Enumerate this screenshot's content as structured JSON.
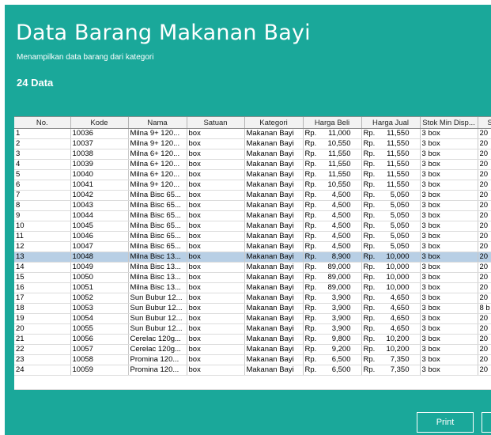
{
  "header": {
    "title": "Data Barang Makanan Bayi",
    "subtitle": "Menampilkan data barang dari kategori",
    "count": "24 Data"
  },
  "table": {
    "columns": [
      "No.",
      "Kode",
      "Nama",
      "Satuan",
      "Kategori",
      "Harga Beli",
      "Harga Jual",
      "Stok Min Disp...",
      "St"
    ],
    "selected_row_index": 12,
    "rows": [
      [
        "1",
        "10036",
        "Milna 9+ 120...",
        "box",
        "Makanan Bayi",
        "Rp.",
        "11,000",
        "Rp.",
        "11,550",
        "3 box",
        "20"
      ],
      [
        "2",
        "10037",
        "Milna 9+ 120...",
        "box",
        "Makanan Bayi",
        "Rp.",
        "10,550",
        "Rp.",
        "11,550",
        "3 box",
        "20"
      ],
      [
        "3",
        "10038",
        "Milna 6+ 120...",
        "box",
        "Makanan Bayi",
        "Rp.",
        "11,550",
        "Rp.",
        "11,550",
        "3 box",
        "20"
      ],
      [
        "4",
        "10039",
        "Milna 6+ 120...",
        "box",
        "Makanan Bayi",
        "Rp.",
        "11,550",
        "Rp.",
        "11,550",
        "3 box",
        "20"
      ],
      [
        "5",
        "10040",
        "Milna 6+ 120...",
        "box",
        "Makanan Bayi",
        "Rp.",
        "11,550",
        "Rp.",
        "11,550",
        "3 box",
        "20"
      ],
      [
        "6",
        "10041",
        "Milna 9+ 120...",
        "box",
        "Makanan Bayi",
        "Rp.",
        "10,550",
        "Rp.",
        "11,550",
        "3 box",
        "20"
      ],
      [
        "7",
        "10042",
        "Milna Bisc 65...",
        "box",
        "Makanan Bayi",
        "Rp.",
        "4,500",
        "Rp.",
        "5,050",
        "3 box",
        "20"
      ],
      [
        "8",
        "10043",
        "Milna Bisc 65...",
        "box",
        "Makanan Bayi",
        "Rp.",
        "4,500",
        "Rp.",
        "5,050",
        "3 box",
        "20"
      ],
      [
        "9",
        "10044",
        "Milna Bisc 65...",
        "box",
        "Makanan Bayi",
        "Rp.",
        "4,500",
        "Rp.",
        "5,050",
        "3 box",
        "20"
      ],
      [
        "10",
        "10045",
        "Milna Bisc 65...",
        "box",
        "Makanan Bayi",
        "Rp.",
        "4,500",
        "Rp.",
        "5,050",
        "3 box",
        "20"
      ],
      [
        "11",
        "10046",
        "Milna Bisc 65...",
        "box",
        "Makanan Bayi",
        "Rp.",
        "4,500",
        "Rp.",
        "5,050",
        "3 box",
        "20"
      ],
      [
        "12",
        "10047",
        "Milna Bisc 65...",
        "box",
        "Makanan Bayi",
        "Rp.",
        "4,500",
        "Rp.",
        "5,050",
        "3 box",
        "20"
      ],
      [
        "13",
        "10048",
        "Milna Bisc 13...",
        "box",
        "Makanan Bayi",
        "Rp.",
        "8,900",
        "Rp.",
        "10,000",
        "3 box",
        "20"
      ],
      [
        "14",
        "10049",
        "Milna Bisc 13...",
        "box",
        "Makanan Bayi",
        "Rp.",
        "89,000",
        "Rp.",
        "10,000",
        "3 box",
        "20"
      ],
      [
        "15",
        "10050",
        "Milna Bisc 13...",
        "box",
        "Makanan Bayi",
        "Rp.",
        "89,000",
        "Rp.",
        "10,000",
        "3 box",
        "20"
      ],
      [
        "16",
        "10051",
        "Milna Bisc 13...",
        "box",
        "Makanan Bayi",
        "Rp.",
        "89,000",
        "Rp.",
        "10,000",
        "3 box",
        "20"
      ],
      [
        "17",
        "10052",
        "Sun Bubur 12...",
        "box",
        "Makanan Bayi",
        "Rp.",
        "3,900",
        "Rp.",
        "4,650",
        "3 box",
        "20"
      ],
      [
        "18",
        "10053",
        "Sun Bubur 12...",
        "box",
        "Makanan Bayi",
        "Rp.",
        "3,900",
        "Rp.",
        "4,650",
        "3 box",
        "8 b"
      ],
      [
        "19",
        "10054",
        "Sun Bubur 12...",
        "box",
        "Makanan Bayi",
        "Rp.",
        "3,900",
        "Rp.",
        "4,650",
        "3 box",
        "20"
      ],
      [
        "20",
        "10055",
        "Sun Bubur 12...",
        "box",
        "Makanan Bayi",
        "Rp.",
        "3,900",
        "Rp.",
        "4,650",
        "3 box",
        "20"
      ],
      [
        "21",
        "10056",
        "Cerelac 120g...",
        "box",
        "Makanan Bayi",
        "Rp.",
        "9,800",
        "Rp.",
        "10,200",
        "3 box",
        "20"
      ],
      [
        "22",
        "10057",
        "Cerelac 120g...",
        "box",
        "Makanan Bayi",
        "Rp.",
        "9,200",
        "Rp.",
        "10,200",
        "3 box",
        "20"
      ],
      [
        "23",
        "10058",
        "Promina 120...",
        "box",
        "Makanan Bayi",
        "Rp.",
        "6,500",
        "Rp.",
        "7,350",
        "3 box",
        "20"
      ],
      [
        "24",
        "10059",
        "Promina 120...",
        "box",
        "Makanan Bayi",
        "Rp.",
        "6,500",
        "Rp.",
        "7,350",
        "3 box",
        "20"
      ]
    ]
  },
  "buttons": {
    "print": "Print",
    "extra": ""
  },
  "colors": {
    "accent": "#1aa89a",
    "selected_row": "#b8cfe5"
  }
}
